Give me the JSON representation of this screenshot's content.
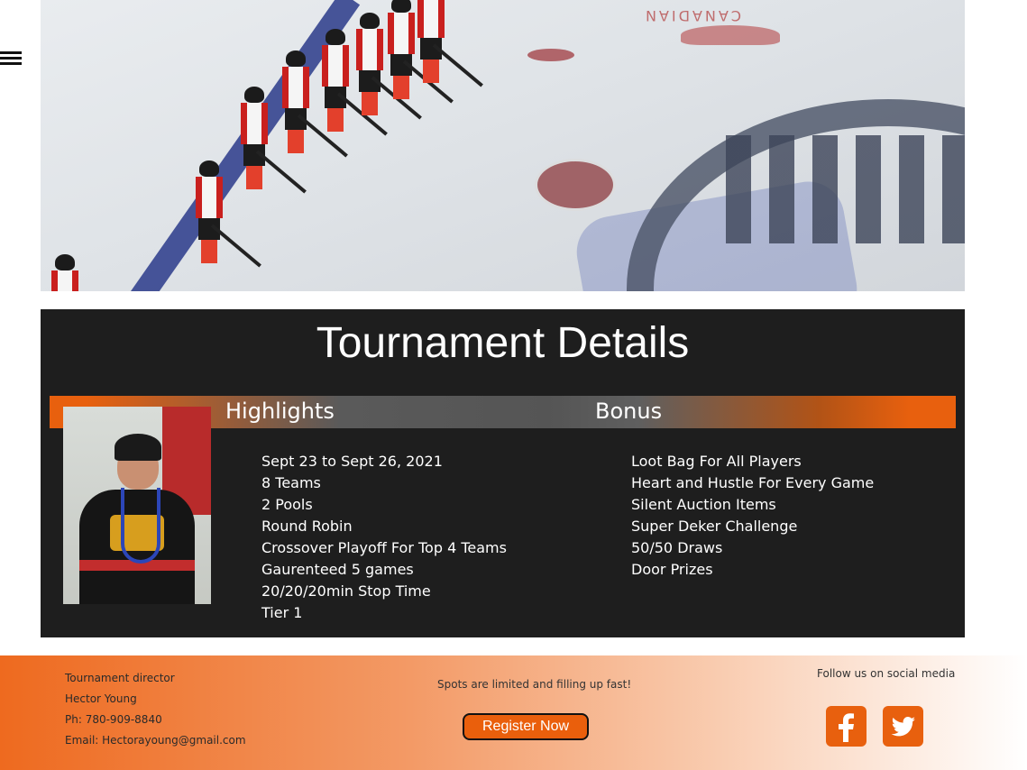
{
  "details": {
    "title": "Tournament Details",
    "highlights_heading": "Highlights",
    "bonus_heading": "Bonus",
    "highlights": [
      "Sept 23 to Sept 26, 2021",
      "8 Teams",
      "2 Pools",
      "Round Robin",
      "Crossover Playoff For Top 4 Teams",
      "Gaurenteed 5 games",
      "20/20/20min Stop Time",
      "Tier 1"
    ],
    "bonus": [
      "Loot Bag For All Players",
      "Heart and Hustle For Every Game",
      "Silent Auction Items",
      "Super Deker Challenge",
      "50/50 Draws",
      "Door Prizes"
    ]
  },
  "hero": {
    "rink_text": "CANADIAN"
  },
  "footer": {
    "director_label": "Tournament director",
    "director_name": "Hector Young",
    "phone": "Ph: 780-909-8840",
    "email": "Email: Hectorayoung@gmail.com",
    "spots": "Spots are limited and filling up fast!",
    "register_label": "Register Now",
    "follow": "Follow us on social media"
  },
  "icons": {
    "menu": "hamburger-menu-icon",
    "facebook": "facebook-icon",
    "twitter": "twitter-icon"
  },
  "colors": {
    "accent": "#e8600e",
    "panel": "#1e1e1e"
  }
}
